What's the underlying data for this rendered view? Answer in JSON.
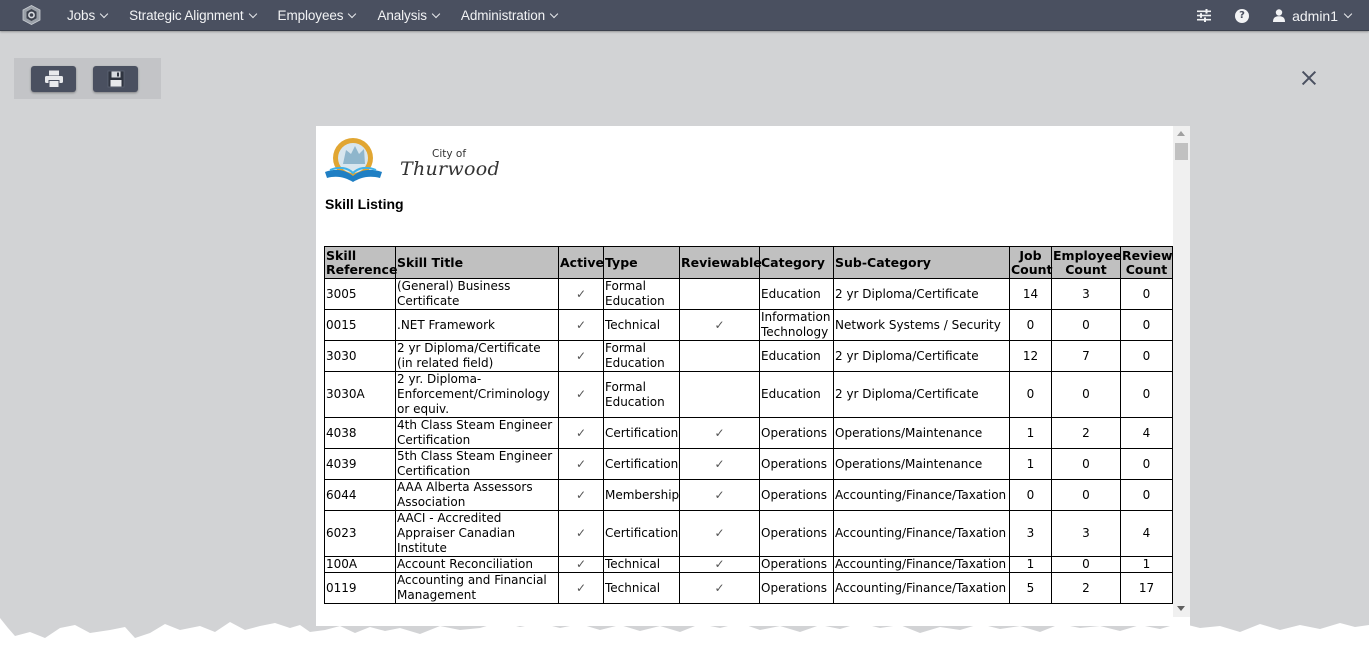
{
  "navbar": {
    "menu": [
      {
        "label": "Jobs"
      },
      {
        "label": "Strategic Alignment"
      },
      {
        "label": "Employees"
      },
      {
        "label": "Analysis"
      },
      {
        "label": "Administration"
      }
    ],
    "icons": {
      "settings": "sliders-icon",
      "help": "?"
    },
    "help_glyph": "?",
    "user": "admin1"
  },
  "toolbar": {
    "print_icon": "printer-icon",
    "save_icon": "floppy-disk-icon"
  },
  "report": {
    "logo_small": "City of",
    "logo_large": "Thurwood",
    "title": "Skill Listing",
    "check_glyph": "✓",
    "columns": [
      "Skill Reference",
      "Skill Title",
      "Active",
      "Type",
      "Reviewable",
      "Category",
      "Sub-Category",
      "Job Count",
      "Employee Count",
      "Review Count"
    ],
    "rows": [
      {
        "ref": "3005",
        "title": "(General) Business Certificate",
        "active": true,
        "type": "Formal Education",
        "reviewable": false,
        "category": "Education",
        "subcategory": "2 yr Diploma/Certificate",
        "job_count": "14",
        "employee_count": "3",
        "review_count": "0"
      },
      {
        "ref": "0015",
        "title": ".NET Framework",
        "active": true,
        "type": "Technical",
        "reviewable": true,
        "category": "Information Technology",
        "subcategory": "Network Systems / Security",
        "job_count": "0",
        "employee_count": "0",
        "review_count": "0"
      },
      {
        "ref": "3030",
        "title": "2 yr Diploma/Certificate (in related field)",
        "active": true,
        "type": "Formal Education",
        "reviewable": false,
        "category": "Education",
        "subcategory": "2 yr Diploma/Certificate",
        "job_count": "12",
        "employee_count": "7",
        "review_count": "0"
      },
      {
        "ref": "3030A",
        "title": "2 yr. Diploma-Enforcement/Criminology or equiv.",
        "active": true,
        "type": "Formal Education",
        "reviewable": false,
        "category": "Education",
        "subcategory": "2 yr Diploma/Certificate",
        "job_count": "0",
        "employee_count": "0",
        "review_count": "0"
      },
      {
        "ref": "4038",
        "title": "4th Class Steam Engineer Certification",
        "active": true,
        "type": "Certification",
        "reviewable": true,
        "category": "Operations",
        "subcategory": "Operations/Maintenance",
        "job_count": "1",
        "employee_count": "2",
        "review_count": "4"
      },
      {
        "ref": "4039",
        "title": "5th Class Steam Engineer Certification",
        "active": true,
        "type": "Certification",
        "reviewable": true,
        "category": "Operations",
        "subcategory": "Operations/Maintenance",
        "job_count": "1",
        "employee_count": "0",
        "review_count": "0"
      },
      {
        "ref": "6044",
        "title": "AAA Alberta Assessors Association",
        "active": true,
        "type": "Membership",
        "reviewable": true,
        "category": "Operations",
        "subcategory": "Accounting/Finance/Taxation",
        "job_count": "0",
        "employee_count": "0",
        "review_count": "0"
      },
      {
        "ref": "6023",
        "title": "AACI - Accredited Appraiser Canadian Institute",
        "active": true,
        "type": "Certification",
        "reviewable": true,
        "category": "Operations",
        "subcategory": "Accounting/Finance/Taxation",
        "job_count": "3",
        "employee_count": "3",
        "review_count": "4"
      },
      {
        "ref": "100A",
        "title": "Account Reconciliation",
        "active": true,
        "type": "Technical",
        "reviewable": true,
        "category": "Operations",
        "subcategory": "Accounting/Finance/Taxation",
        "job_count": "1",
        "employee_count": "0",
        "review_count": "1"
      },
      {
        "ref": "0119",
        "title": "Accounting and Financial Management",
        "active": true,
        "type": "Technical",
        "reviewable": true,
        "category": "Operations",
        "subcategory": "Accounting/Finance/Taxation",
        "job_count": "5",
        "employee_count": "2",
        "review_count": "17"
      }
    ]
  },
  "colors": {
    "navbar_bg": "#4a5060",
    "page_bg": "#d2d3d5",
    "table_header_bg": "#c0c0c0"
  }
}
